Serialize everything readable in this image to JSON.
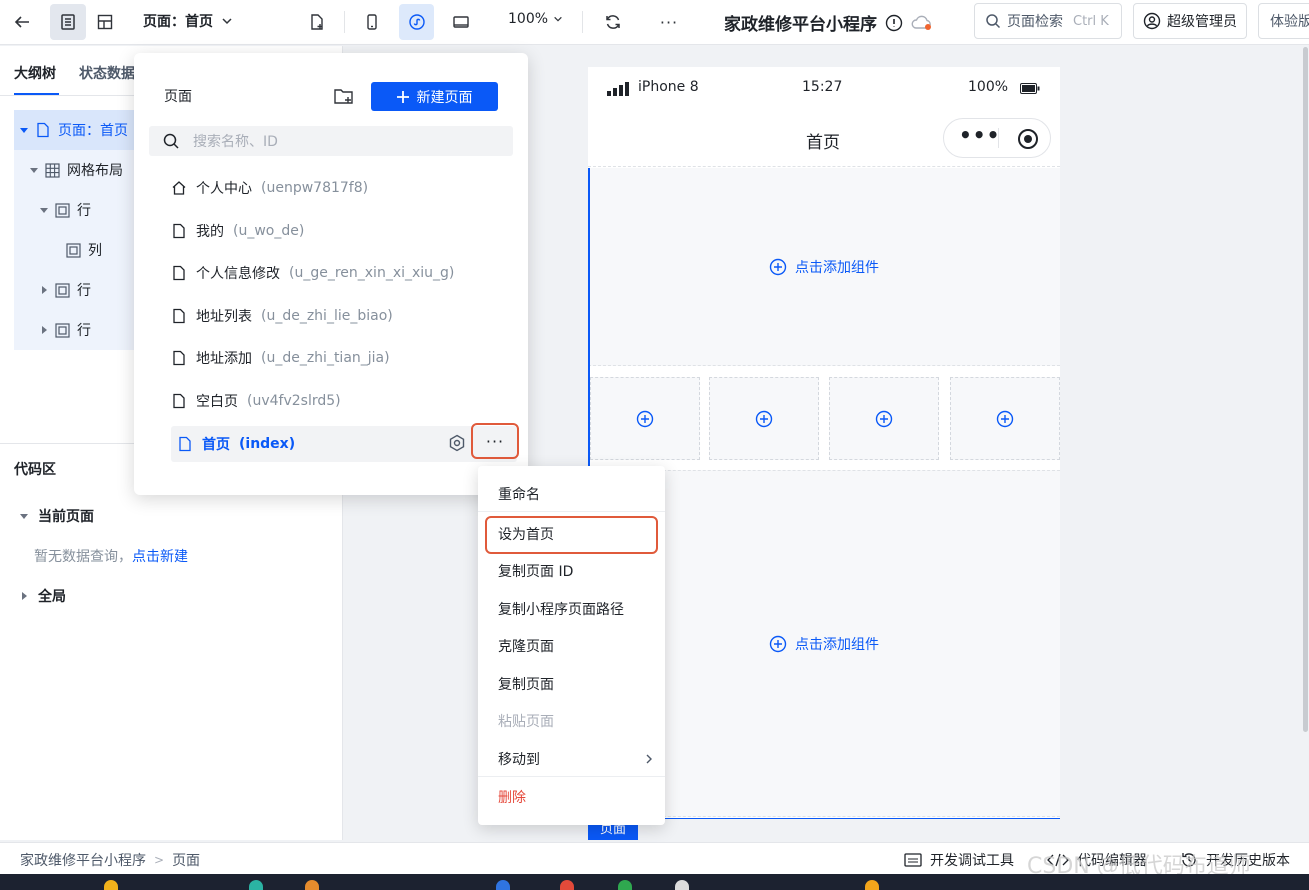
{
  "toolbar": {
    "page_select": "页面：首页",
    "zoom": "100%",
    "app_title": "家政维修平台小程序",
    "search_placeholder": "页面检索",
    "search_shortcut": "Ctrl K",
    "user": "超级管理员",
    "experience": "体验版"
  },
  "left_panel": {
    "tabs": [
      "大纲树",
      "状态数据"
    ],
    "tree": {
      "page": "页面：首页",
      "grid": "网格布局",
      "row": "行",
      "col": "列"
    },
    "code_area": "代码区",
    "current_page": "当前页面",
    "empty_tip": "暂无数据查询，",
    "create_link": "点击新建",
    "global": "全局"
  },
  "page_popover": {
    "title": "页面",
    "new_page": "新建页面",
    "search_placeholder": "搜索名称、ID",
    "pages": [
      {
        "name": "个人中心",
        "id": "(uenpw7817f8)",
        "icon": "home-icon"
      },
      {
        "name": "我的",
        "id": "(u_wo_de)",
        "icon": "page-icon"
      },
      {
        "name": "个人信息修改",
        "id": "(u_ge_ren_xin_xi_xiu_g)",
        "icon": "page-icon"
      },
      {
        "name": "地址列表",
        "id": "(u_de_zhi_lie_biao)",
        "icon": "page-icon"
      },
      {
        "name": "地址添加",
        "id": "(u_de_zhi_tian_jia)",
        "icon": "page-icon"
      },
      {
        "name": "空白页",
        "id": "(uv4fv2slrd5)",
        "icon": "page-icon"
      },
      {
        "name": "首页",
        "id": "(index)",
        "icon": "page-icon",
        "active": true
      }
    ]
  },
  "context_menu": {
    "items": [
      "重命名",
      "设为首页",
      "复制页面 ID",
      "复制小程序页面路径",
      "克隆页面",
      "复制页面",
      "粘贴页面",
      "移动到",
      "删除"
    ],
    "disabled": "粘贴页面",
    "danger": "删除"
  },
  "phone": {
    "device": "iPhone 8",
    "time": "15:27",
    "battery": "100%",
    "nav_title": "首页",
    "add_component": "点击添加组件",
    "page_tag": "页面"
  },
  "footer": {
    "breadcrumb": [
      "家政维修平台小程序",
      "页面"
    ],
    "dev_tools": "开发调试工具",
    "code_editor": "代码编辑器",
    "history": "开发历史版本"
  },
  "watermark": "CSDN @低代码布道师",
  "colors": {
    "accent": "#0a59f7",
    "highlight_border": "#e05a3b",
    "danger": "#e5483a"
  }
}
